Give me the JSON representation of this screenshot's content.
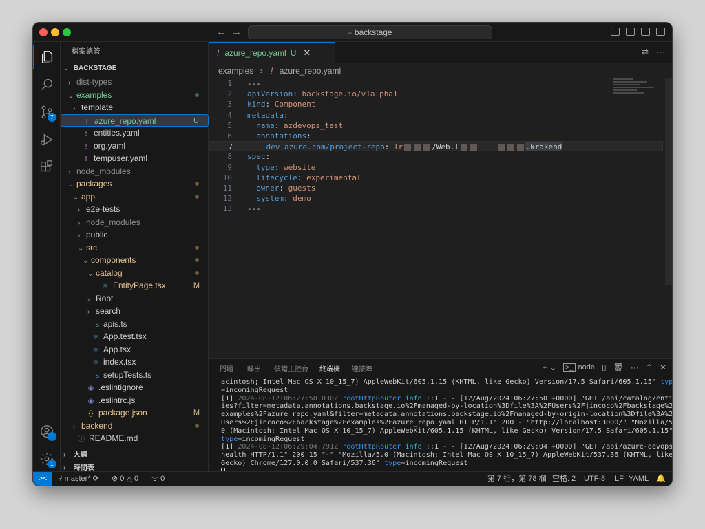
{
  "window": {
    "search_label": "backstage",
    "nav_back": "←",
    "nav_forward": "→"
  },
  "activity": {
    "explorer_icon": "files-icon",
    "search_icon": "search-icon",
    "scm_icon": "source-control-icon",
    "scm_badge": "7",
    "run_icon": "run-debug-icon",
    "extensions_icon": "extensions-icon",
    "account_icon": "account-icon",
    "account_badge": "1",
    "settings_icon": "gear-icon",
    "settings_badge": "1"
  },
  "sidebar": {
    "title": "檔案總管",
    "more": "···",
    "root": "BACKSTAGE",
    "items": [
      {
        "label": "dist-types",
        "chev": "›",
        "icon": "",
        "color": "grey",
        "dot": false,
        "mark": ""
      },
      {
        "label": "examples",
        "chev": "⌄",
        "icon": "",
        "color": "green",
        "dot": true,
        "mark": ""
      },
      {
        "label": "template",
        "chev": "›",
        "icon": "",
        "color": "white",
        "dot": false,
        "mark": ""
      },
      {
        "label": "azure_repo.yaml",
        "chev": "",
        "icon": "!",
        "color": "green",
        "dot": false,
        "mark": "U"
      },
      {
        "label": "entities.yaml",
        "chev": "",
        "icon": "!",
        "color": "white",
        "dot": false,
        "mark": ""
      },
      {
        "label": "org.yaml",
        "chev": "",
        "icon": "!",
        "color": "white",
        "dot": false,
        "mark": ""
      },
      {
        "label": "tempuser.yaml",
        "chev": "",
        "icon": "!",
        "color": "white",
        "dot": false,
        "mark": ""
      },
      {
        "label": "node_modules",
        "chev": "›",
        "icon": "",
        "color": "grey",
        "dot": false,
        "mark": ""
      },
      {
        "label": "packages",
        "chev": "⌄",
        "icon": "",
        "color": "yellow",
        "dot": true,
        "mark": ""
      },
      {
        "label": "app",
        "chev": "⌄",
        "icon": "",
        "color": "yellow",
        "dot": true,
        "mark": ""
      },
      {
        "label": "e2e-tests",
        "chev": "›",
        "icon": "",
        "color": "white",
        "dot": false,
        "mark": ""
      },
      {
        "label": "node_modules",
        "chev": "›",
        "icon": "",
        "color": "grey",
        "dot": false,
        "mark": ""
      },
      {
        "label": "public",
        "chev": "›",
        "icon": "",
        "color": "white",
        "dot": false,
        "mark": ""
      },
      {
        "label": "src",
        "chev": "⌄",
        "icon": "",
        "color": "yellow",
        "dot": true,
        "mark": ""
      },
      {
        "label": "components",
        "chev": "⌄",
        "icon": "",
        "color": "yellow",
        "dot": true,
        "mark": ""
      },
      {
        "label": "catalog",
        "chev": "⌄",
        "icon": "",
        "color": "yellow",
        "dot": true,
        "mark": ""
      },
      {
        "label": "EntityPage.tsx",
        "chev": "",
        "icon": "⚛",
        "color": "yellow",
        "dot": false,
        "mark": "M"
      },
      {
        "label": "Root",
        "chev": "›",
        "icon": "",
        "color": "white",
        "dot": false,
        "mark": ""
      },
      {
        "label": "search",
        "chev": "›",
        "icon": "",
        "color": "white",
        "dot": false,
        "mark": ""
      },
      {
        "label": "apis.ts",
        "chev": "",
        "icon": "TS",
        "color": "white",
        "dot": false,
        "mark": ""
      },
      {
        "label": "App.test.tsx",
        "chev": "",
        "icon": "⚛",
        "color": "white",
        "dot": false,
        "mark": ""
      },
      {
        "label": "App.tsx",
        "chev": "",
        "icon": "⚛",
        "color": "white",
        "dot": false,
        "mark": ""
      },
      {
        "label": "index.tsx",
        "chev": "",
        "icon": "⚛",
        "color": "white",
        "dot": false,
        "mark": ""
      },
      {
        "label": "setupTests.ts",
        "chev": "",
        "icon": "TS",
        "color": "white",
        "dot": false,
        "mark": ""
      },
      {
        "label": ".eslintignore",
        "chev": "",
        "icon": "◉",
        "color": "white",
        "dot": false,
        "mark": ""
      },
      {
        "label": ".eslintrc.js",
        "chev": "",
        "icon": "◉",
        "color": "white",
        "dot": false,
        "mark": ""
      },
      {
        "label": "package.json",
        "chev": "",
        "icon": "{}",
        "color": "yellow",
        "dot": false,
        "mark": "M"
      },
      {
        "label": "backend",
        "chev": "›",
        "icon": "",
        "color": "yellow",
        "dot": true,
        "mark": ""
      },
      {
        "label": "README.md",
        "chev": "",
        "icon": "ⓘ",
        "color": "white",
        "dot": false,
        "mark": ""
      }
    ],
    "outline": "大綱",
    "timeline": "時間表"
  },
  "editor": {
    "tab_label": "azure_repo.yaml",
    "tab_status": "U",
    "breadcrumb_folder": "examples",
    "breadcrumb_sep": "›",
    "breadcrumb_file": "azure_repo.yaml",
    "lines": [
      {
        "n": "1",
        "text": "---"
      },
      {
        "n": "2",
        "text": "apiVersion: backstage.io/v1alpha1"
      },
      {
        "n": "3",
        "text": "kind: Component"
      },
      {
        "n": "4",
        "text": "metadata:"
      },
      {
        "n": "5",
        "text": "  name: azdevops_test"
      },
      {
        "n": "6",
        "text": "  annotations:"
      },
      {
        "n": "7",
        "text": "    dev.azure.com/project-repo: Tr"
      },
      {
        "n": "8",
        "text": "spec:"
      },
      {
        "n": "9",
        "text": "  type: website"
      },
      {
        "n": "10",
        "text": "  lifecycle: experimental"
      },
      {
        "n": "11",
        "text": "  owner: guests"
      },
      {
        "n": "12",
        "text": "  system: demo"
      },
      {
        "n": "13",
        "text": "---"
      }
    ],
    "line7_mid": "/Web.l",
    "line7_end": ".krakend"
  },
  "panel": {
    "tabs": [
      "問題",
      "輸出",
      "偵錯主控台",
      "終端機",
      "連接埠"
    ],
    "active_tab": "終端機",
    "shell": "node",
    "terminal": [
      "acintosh; Intel Mac OS X 10_15_7) AppleWebKit/605.1.15 (KHTML, like Gecko) Version/17.5 Safari/605.1.15\" type",
      "=incomingRequest",
      "[1] 2024-08-12T06:27:50.030Z rootHttpRouter info ::1 - - [12/Aug/2024:06:27:50 +0000] \"GET /api/catalog/entit",
      "ies?filter=metadata.annotations.backstage.io%2Fmanaged-by-location%3Dfile%3A%2FUsers%2Fjincoco%2Fbackstage%2F",
      "examples%2Fazure_repo.yaml&filter=metadata.annotations.backstage.io%2Fmanaged-by-origin-location%3Dfile%3A%2F",
      "Users%2Fjincoco%2Fbackstage%2Fexamples%2Fazure_repo.yaml HTTP/1.1\" 200 - \"http://localhost:3000/\" \"Mozilla/5.",
      "0 (Macintosh; Intel Mac OS X 10_15_7) AppleWebKit/605.1.15 (KHTML, like Gecko) Version/17.5 Safari/605.1.15\"",
      "type=incomingRequest",
      "[1] 2024-08-12T06:29:04.791Z rootHttpRouter info ::1 - - [12/Aug/2024:06:29:04 +0000] \"GET /api/azure-devops/",
      "health HTTP/1.1\" 200 15 \"-\" \"Mozilla/5.0 (Macintosh; Intel Mac OS X 10_15_7) AppleWebKit/537.36 (KHTML, like",
      "Gecko) Chrome/127.0.0.0 Safari/537.36\" type=incomingRequest"
    ]
  },
  "status": {
    "remote": "><",
    "branch": "master*",
    "errors": "0",
    "warnings": "0",
    "ports": "0",
    "position": "第 7 行，第 78 欄",
    "spaces": "空格: 2",
    "encoding": "UTF-8",
    "eol": "LF",
    "language": "YAML"
  }
}
